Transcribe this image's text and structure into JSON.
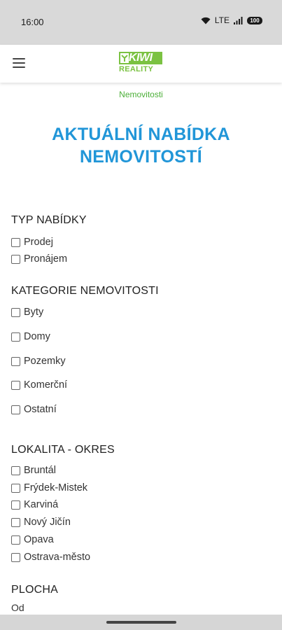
{
  "status_bar": {
    "time": "16:00",
    "network": "LTE",
    "battery": "100"
  },
  "header": {
    "logo_kiwi": "KIWI",
    "logo_reality": "REALITY"
  },
  "breadcrumb": "Nemovitosti",
  "page_title_line1": "AKTUÁLNÍ NABÍDKA",
  "page_title_line2": "NEMOVITOSTÍ",
  "filters": {
    "typ_nabidky": {
      "heading": "TYP NABÍDKY",
      "options": [
        "Prodej",
        "Pronájem"
      ]
    },
    "kategorie": {
      "heading": "KATEGORIE NEMOVITOSTI",
      "options": [
        "Byty",
        "Domy",
        "Pozemky",
        "Komerční",
        "Ostatní"
      ]
    },
    "lokalita": {
      "heading": "LOKALITA - OKRES",
      "options": [
        "Bruntál",
        "Frýdek-Mistek",
        "Karviná",
        "Nový Jičín",
        "Opava",
        "Ostrava-město"
      ]
    },
    "plocha": {
      "heading": "PLOCHA",
      "from_label": "Od"
    }
  },
  "colors": {
    "title": "#2196d8",
    "breadcrumb": "#4caf38",
    "logo_green": "#7bc242"
  }
}
